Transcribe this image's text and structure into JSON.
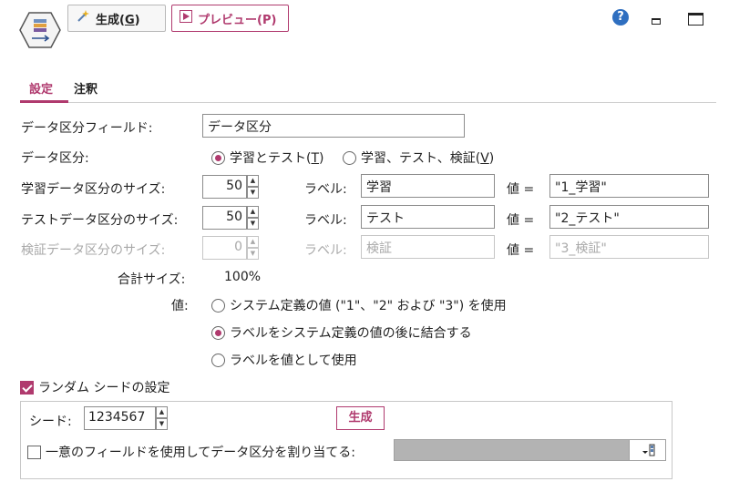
{
  "toolbar": {
    "generate_label": "生成(",
    "generate_key": "G",
    "generate_close": ")",
    "preview_label": "プレビュー(P)",
    "help_glyph": "?",
    "icons": [
      "partition-node-icon",
      "wand-icon",
      "play-icon",
      "help-icon",
      "minimize-icon",
      "maximize-icon"
    ]
  },
  "tabs": [
    {
      "label": "設定",
      "active": true
    },
    {
      "label": "注釈",
      "active": false
    }
  ],
  "form": {
    "partition_field_label": "データ区分フィールド:",
    "partition_field_value": "データ区分",
    "partitions_label": "データ区分:",
    "partition_opt1_text": "学習とテスト(",
    "partition_opt1_key": "T",
    "partition_opt2_text": "学習、テスト、検証(",
    "partition_opt2_key": "V",
    "close_paren": ")",
    "selected_partition": "学習とテスト(T)",
    "train_size_label": "学習データ区分のサイズ:",
    "train_size": "50",
    "train_label_caption": "ラベル:",
    "train_label_value": "学習",
    "train_value_caption": "値 =",
    "train_value": "\"1_学習\"",
    "test_size_label": "テストデータ区分のサイズ:",
    "test_size": "50",
    "test_label_caption": "ラベル:",
    "test_label_value": "テスト",
    "test_value_caption": "値 =",
    "test_value": "\"2_テスト\"",
    "valid_size_label": "検証データ区分のサイズ:",
    "valid_size": "0",
    "valid_label_caption": "ラベル:",
    "valid_label_value": "検証",
    "valid_value_caption": "値 =",
    "valid_value": "\"3_検証\"",
    "total_label": "合計サイズ:",
    "total_value": "100%",
    "values_label": "値:",
    "values_opt1": "システム定義の値 (\"1\"、\"2\" および \"3\") を使用",
    "values_opt2": "ラベルをシステム定義の値の後に結合する",
    "values_opt3": "ラベルを値として使用",
    "selected_values_option": "ラベルをシステム定義の値の後に結合する",
    "random_seed_label": "ランダム シードの設定",
    "random_seed_checked": true,
    "seed_label": "シード:",
    "seed_value": "1234567",
    "generate_button": "生成",
    "unique_field_label": "一意のフィールドを使用してデータ区分を割り当てる:",
    "unique_field_checked": false,
    "unique_field_value": ""
  },
  "colors": {
    "accent": "#b03a6e",
    "help": "#2f6fc0",
    "disabled": "#a9a9a9",
    "dropdown": "#b3b3b3"
  }
}
